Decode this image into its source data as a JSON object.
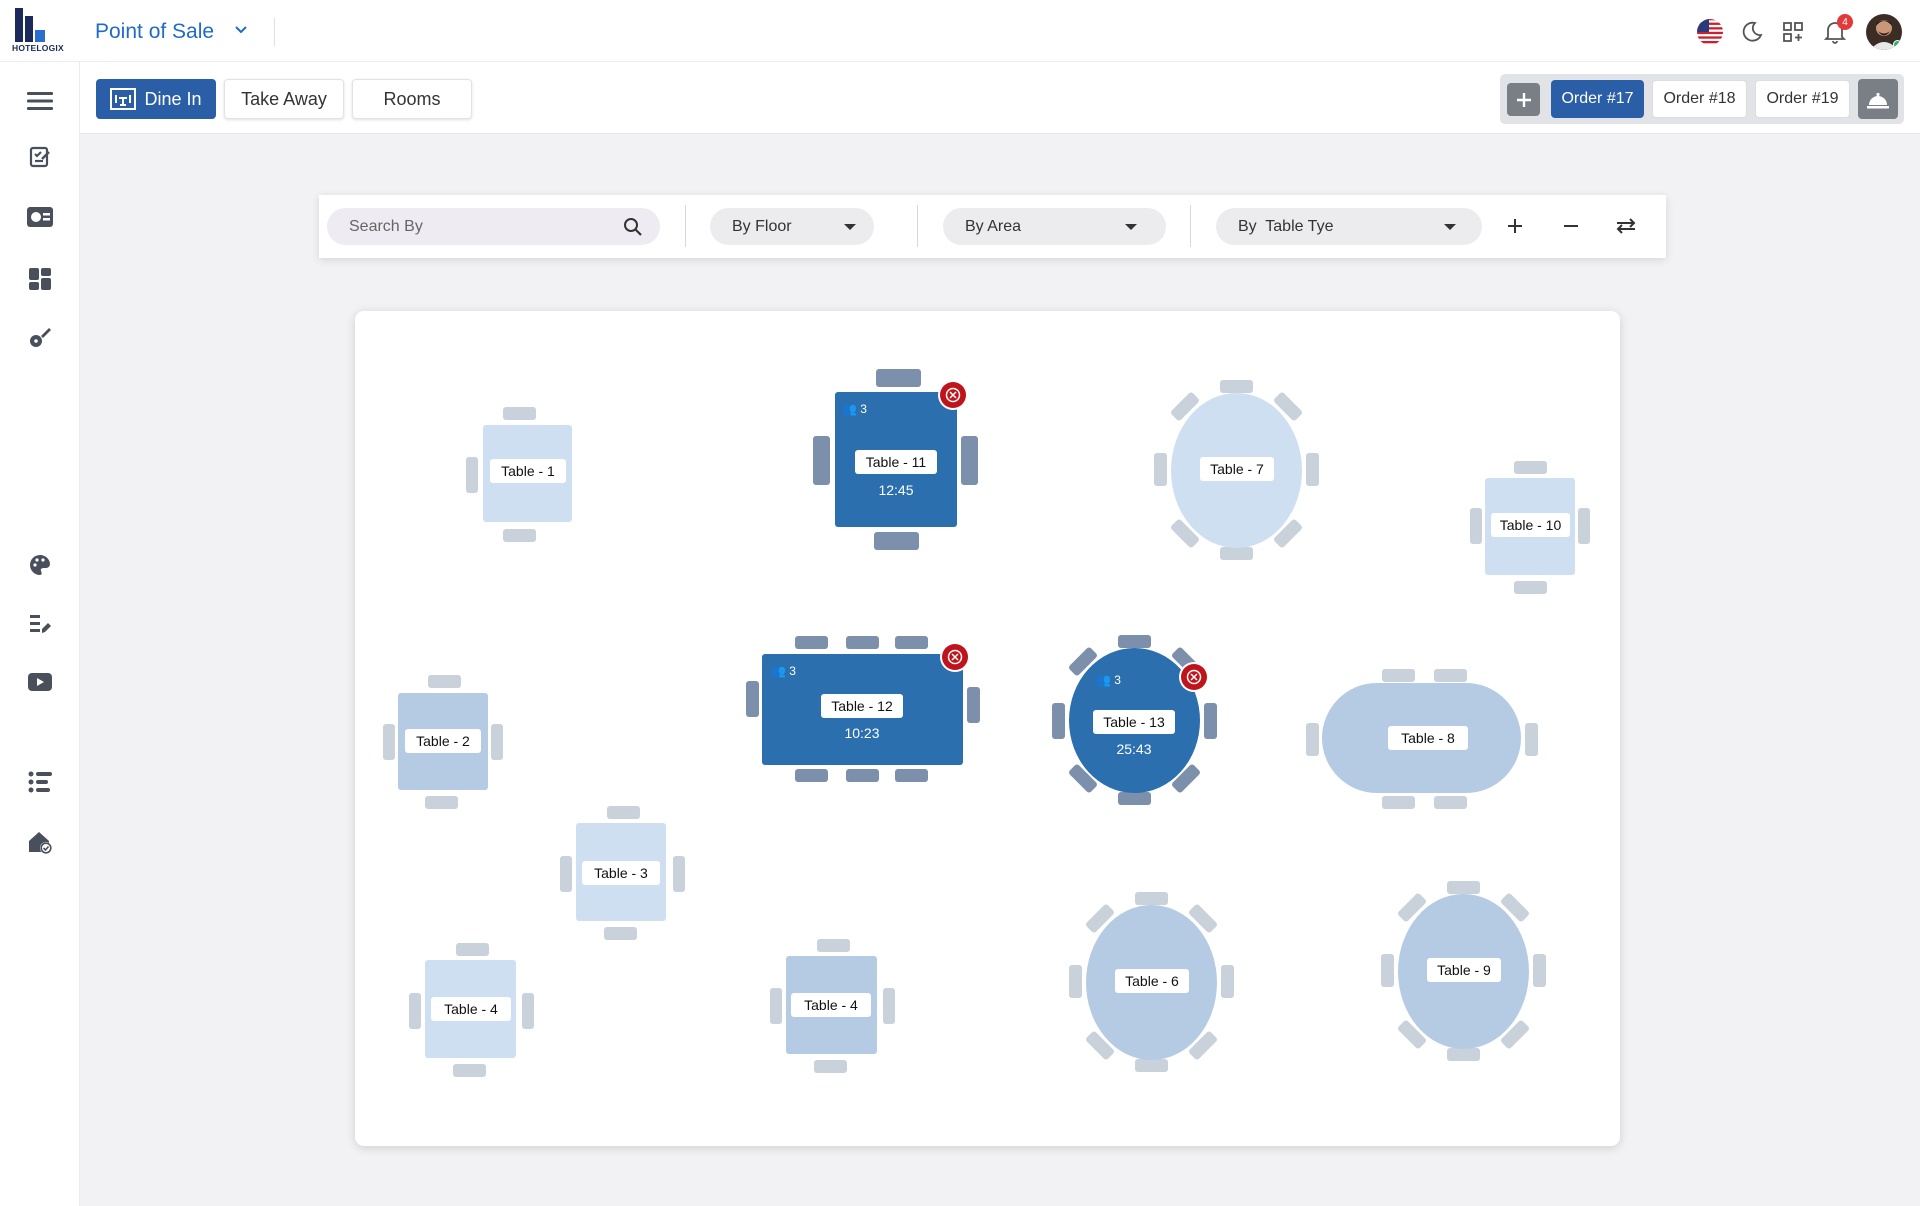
{
  "app": {
    "logo_text": "HOTELOGIX",
    "title": "Point of Sale"
  },
  "header": {
    "notification_count": "4",
    "icons": [
      "us-flag-icon",
      "moon-icon",
      "apps-icon",
      "bell-icon",
      "avatar"
    ]
  },
  "sidebar": {
    "icons": [
      "menu-icon",
      "orders-icon",
      "billing-icon",
      "dashboard-icon",
      "guitar-icon",
      "palette-icon",
      "reports-icon",
      "video-icon",
      "list-icon",
      "house-check-icon"
    ]
  },
  "tabs": [
    {
      "label": "Dine In",
      "active": true
    },
    {
      "label": "Take Away",
      "active": false
    },
    {
      "label": "Rooms",
      "active": false
    }
  ],
  "orders": [
    {
      "label": "Order #17",
      "active": true
    },
    {
      "label": "Order #18",
      "active": false
    },
    {
      "label": "Order #19",
      "active": false
    }
  ],
  "filters": {
    "search_placeholder": "Search By",
    "floor": "By Floor",
    "area": "By Area",
    "table_type": "By  Table Tye"
  },
  "tables": [
    {
      "label": "Table - 1",
      "status": "free"
    },
    {
      "label": "Table - 11",
      "status": "occupied",
      "guests": "3",
      "time": "12:45"
    },
    {
      "label": "Table - 7",
      "status": "free"
    },
    {
      "label": "Table - 10",
      "status": "free"
    },
    {
      "label": "Table - 2",
      "status": "reserved"
    },
    {
      "label": "Table - 12",
      "status": "occupied",
      "guests": "3",
      "time": "10:23"
    },
    {
      "label": "Table - 13",
      "status": "occupied",
      "guests": "3",
      "time": "25:43"
    },
    {
      "label": "Table - 8",
      "status": "reserved"
    },
    {
      "label": "Table - 3",
      "status": "free"
    },
    {
      "label": "Table - 4",
      "status": "free"
    },
    {
      "label": "Table - 4",
      "status": "reserved"
    },
    {
      "label": "Table - 6",
      "status": "reserved"
    },
    {
      "label": "Table - 9",
      "status": "reserved"
    }
  ],
  "colors": {
    "accent": "#2a5ea6",
    "occupied": "#2c6fae",
    "free": "#cfdff2",
    "reserved": "#b5cbe3",
    "alert": "#c0141c",
    "title": "#1e6cc8"
  }
}
